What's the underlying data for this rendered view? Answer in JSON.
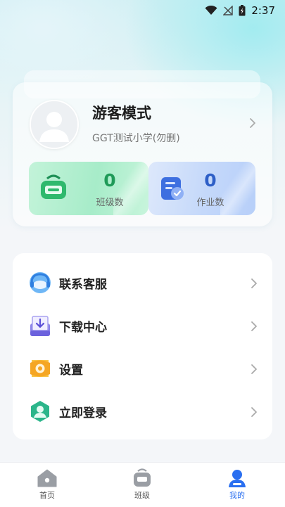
{
  "status_bar": {
    "time": "2:37"
  },
  "profile": {
    "name": "游客模式",
    "school": "GGT测试小学(勿删)"
  },
  "stats": [
    {
      "value": "0",
      "label": "班级数"
    },
    {
      "value": "0",
      "label": "作业数"
    }
  ],
  "menu": [
    {
      "label": "联系客服",
      "icon": "customer-service-icon"
    },
    {
      "label": "下载中心",
      "icon": "download-tray-icon"
    },
    {
      "label": "设置",
      "icon": "settings-icon"
    },
    {
      "label": "立即登录",
      "icon": "login-user-icon"
    }
  ],
  "bottom_nav": [
    {
      "label": "首页",
      "icon": "home-icon",
      "active": false
    },
    {
      "label": "班级",
      "icon": "class-icon",
      "active": false
    },
    {
      "label": "我的",
      "icon": "profile-icon",
      "active": true
    }
  ],
  "colors": {
    "accent": "#2a6ff0",
    "green": "#1f9a58",
    "blue": "#2e5fc7"
  }
}
